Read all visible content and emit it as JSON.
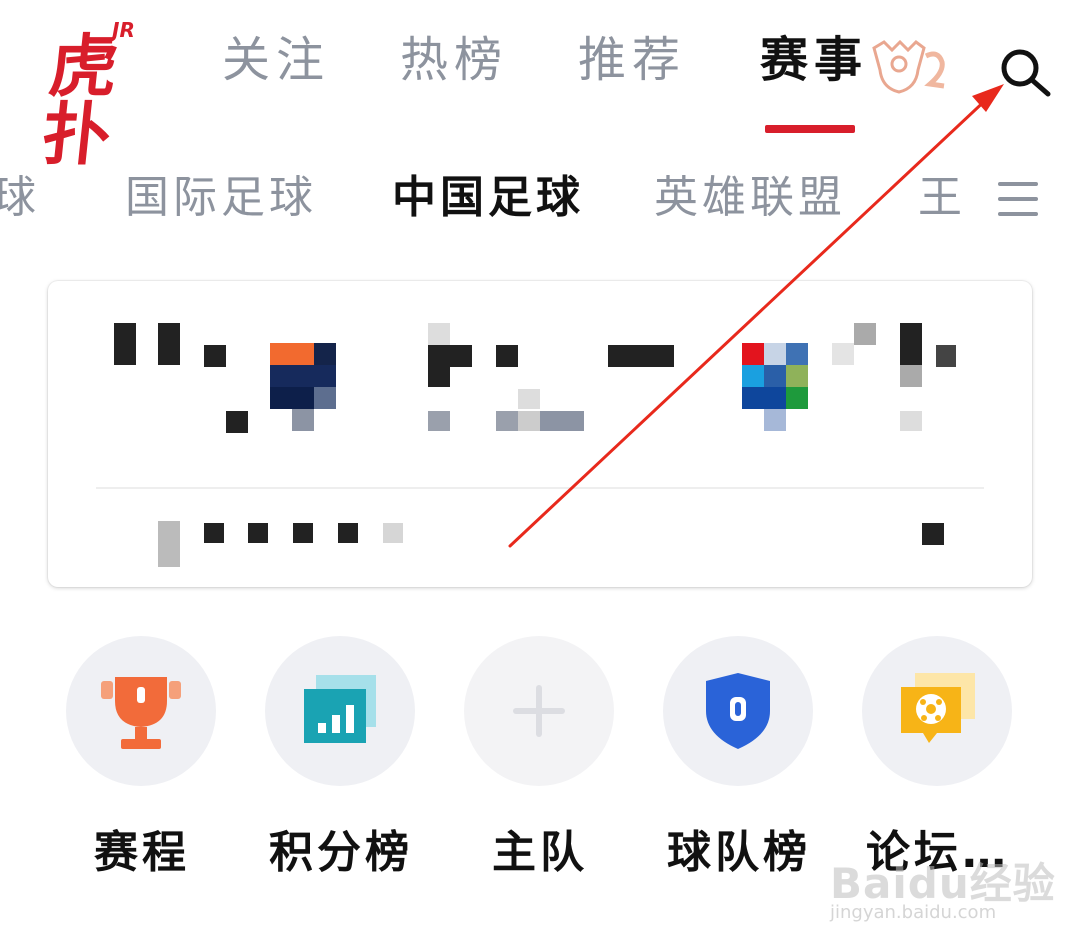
{
  "app": {
    "logo_text": "虎扑",
    "logo_badge": "JR"
  },
  "main_tabs": [
    {
      "label": "关注",
      "active": false
    },
    {
      "label": "热榜",
      "active": false
    },
    {
      "label": "推荐",
      "active": false
    },
    {
      "label": "赛事",
      "active": true
    }
  ],
  "sub_tabs": [
    {
      "label": "球",
      "active": false
    },
    {
      "label": "国际足球",
      "active": false
    },
    {
      "label": "中国足球",
      "active": true
    },
    {
      "label": "英雄联盟",
      "active": false
    },
    {
      "label": "王",
      "active": false
    }
  ],
  "icons": {
    "search": "search-icon",
    "menu": "menu-icon",
    "trophy": "trophy-icon",
    "standings": "bar-chart-icon",
    "add": "plus-icon",
    "shield": "shield-icon",
    "forum": "soccer-chat-icon"
  },
  "shortcuts": [
    {
      "label": "赛程",
      "icon": "trophy-icon"
    },
    {
      "label": "积分榜",
      "icon": "bar-chart-icon"
    },
    {
      "label": "主队",
      "icon": "plus-icon"
    },
    {
      "label": "球队榜",
      "icon": "shield-icon"
    },
    {
      "label": "论坛…",
      "icon": "soccer-chat-icon"
    }
  ],
  "colors": {
    "brand_red": "#d81e2b",
    "inactive_tab": "#8d939e",
    "active_text": "#111111",
    "annotation_arrow": "#e8291c"
  },
  "watermark": {
    "brand": "Baidu经验",
    "url": "jingyan.baidu.com"
  }
}
